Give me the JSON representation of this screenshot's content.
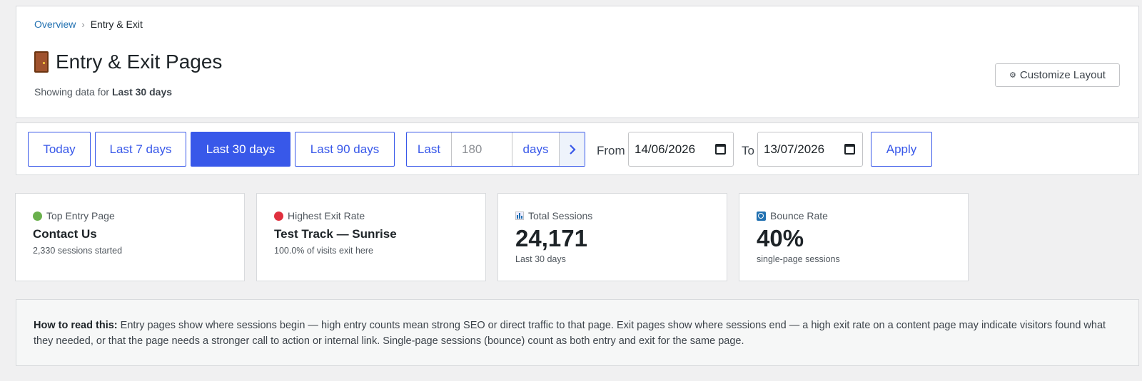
{
  "breadcrumb": {
    "parent": "Overview",
    "separator": "›",
    "current": "Entry & Exit"
  },
  "header": {
    "title": "Entry & Exit Pages",
    "subtitle_prefix": "Showing data for",
    "subtitle_range": "Last 30 days",
    "title_icon": "door-icon"
  },
  "toolbar": {
    "customize_icon": "⚙",
    "customize_label": "Customize Layout"
  },
  "filters": {
    "ranges": [
      {
        "label": "Today",
        "active": false
      },
      {
        "label": "Last 7 days",
        "active": false
      },
      {
        "label": "Last 30 days",
        "active": true
      },
      {
        "label": "Last 90 days",
        "active": false
      }
    ],
    "custom": {
      "prefix": "Last",
      "placeholder": "180",
      "suffix": "days",
      "next_icon": "›"
    },
    "from_label": "From",
    "from_value": "14/06/2026",
    "to_label": "To",
    "to_value": "13/07/2026",
    "apply_label": "Apply"
  },
  "stats": [
    {
      "label": "Top Entry Page",
      "value": "Contact Us",
      "sub": "2,330 sessions started",
      "icon": "green-circle-icon",
      "color": "#6ab04c"
    },
    {
      "label": "Highest Exit Rate",
      "value": "Test Track — Sunrise",
      "sub": "100.0% of visits exit here",
      "icon": "red-circle-icon",
      "color": "#e0303e"
    },
    {
      "label": "Total Sessions",
      "value": "24,171",
      "sub": "Last 30 days",
      "icon": "bar-chart-icon"
    },
    {
      "label": "Bounce Rate",
      "value": "40%",
      "sub": "single-page sessions",
      "icon": "bounce-icon"
    }
  ],
  "info": {
    "heading": "How to read this:",
    "body": " Entry pages show where sessions begin — high entry counts mean strong SEO or direct traffic to that page. Exit pages show where sessions end — a high exit rate on a content page may indicate visitors found what they needed, or that the page needs a stronger call to action or internal link. Single-page sessions (bounce) count as both entry and exit for the same page."
  },
  "colors": {
    "accent": "#3858e9",
    "link": "#2271b1"
  }
}
